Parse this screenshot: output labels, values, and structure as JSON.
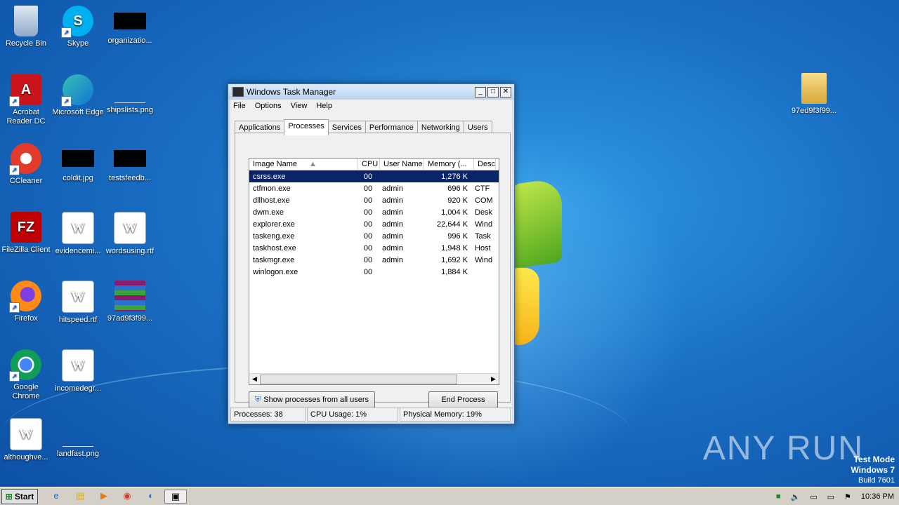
{
  "desktop": {
    "icons": [
      {
        "label": "Recycle Bin",
        "icon": "recycle-bin-icon"
      },
      {
        "label": "Skype",
        "icon": "skype-icon"
      },
      {
        "label": "organizatio...",
        "icon": "image-file-icon"
      },
      {
        "label": "Acrobat Reader DC",
        "icon": "acrobat-icon"
      },
      {
        "label": "Microsoft Edge",
        "icon": "edge-icon"
      },
      {
        "label": "shipslists.png",
        "icon": "image-file-icon"
      },
      {
        "label": "CCleaner",
        "icon": "ccleaner-icon"
      },
      {
        "label": "coldit.jpg",
        "icon": "image-file-icon"
      },
      {
        "label": "testsfeedb...",
        "icon": "image-file-icon"
      },
      {
        "label": "FileZilla Client",
        "icon": "filezilla-icon"
      },
      {
        "label": "evidencemi...",
        "icon": "word-doc-icon"
      },
      {
        "label": "wordsusing.rtf",
        "icon": "word-doc-icon"
      },
      {
        "label": "Firefox",
        "icon": "firefox-icon"
      },
      {
        "label": "hitspeed.rtf",
        "icon": "word-doc-icon"
      },
      {
        "label": "97ad9f3f99...",
        "icon": "winrar-archive-icon"
      },
      {
        "label": "Google Chrome",
        "icon": "chrome-icon"
      },
      {
        "label": "incomedegr...",
        "icon": "word-doc-icon"
      },
      {
        "label": "althoughve...",
        "icon": "word-doc-icon"
      },
      {
        "label": "landfast.png",
        "icon": "image-file-icon"
      },
      {
        "label": "97ed9f3f99...",
        "icon": "folder-icon"
      }
    ]
  },
  "window": {
    "title": "Windows Task Manager",
    "menu": [
      "File",
      "Options",
      "View",
      "Help"
    ],
    "tabs": [
      "Applications",
      "Processes",
      "Services",
      "Performance",
      "Networking",
      "Users"
    ],
    "active_tab": "Processes",
    "columns": [
      "Image Name",
      "CPU",
      "User Name",
      "Memory (...",
      "Desc"
    ],
    "rows": [
      {
        "name": "csrss.exe",
        "cpu": "00",
        "user": "",
        "mem": "1,276 K",
        "desc": ""
      },
      {
        "name": "ctfmon.exe",
        "cpu": "00",
        "user": "admin",
        "mem": "696 K",
        "desc": "CTF I"
      },
      {
        "name": "dllhost.exe",
        "cpu": "00",
        "user": "admin",
        "mem": "920 K",
        "desc": "COM"
      },
      {
        "name": "dwm.exe",
        "cpu": "00",
        "user": "admin",
        "mem": "1,004 K",
        "desc": "Desk"
      },
      {
        "name": "explorer.exe",
        "cpu": "00",
        "user": "admin",
        "mem": "22,644 K",
        "desc": "Wind"
      },
      {
        "name": "taskeng.exe",
        "cpu": "00",
        "user": "admin",
        "mem": "996 K",
        "desc": "Task"
      },
      {
        "name": "taskhost.exe",
        "cpu": "00",
        "user": "admin",
        "mem": "1,948 K",
        "desc": "Host"
      },
      {
        "name": "taskmgr.exe",
        "cpu": "00",
        "user": "admin",
        "mem": "1,692 K",
        "desc": "Wind"
      },
      {
        "name": "winlogon.exe",
        "cpu": "00",
        "user": "",
        "mem": "1,884 K",
        "desc": ""
      }
    ],
    "show_all_label": "Show processes from all users",
    "end_process_label": "End Process",
    "status": {
      "processes": "Processes: 38",
      "cpu": "CPU Usage: 1%",
      "memory": "Physical Memory: 19%"
    }
  },
  "taskbar": {
    "start_label": "Start",
    "clock": "10:36 PM"
  },
  "watermark": "ANY RUN",
  "os_notice": {
    "line1": "Test Mode",
    "line2": "Windows 7",
    "line3": "Build 7601"
  },
  "colors": {
    "selection": "#0a246a",
    "desktop_blue": "#1a6fc4"
  }
}
